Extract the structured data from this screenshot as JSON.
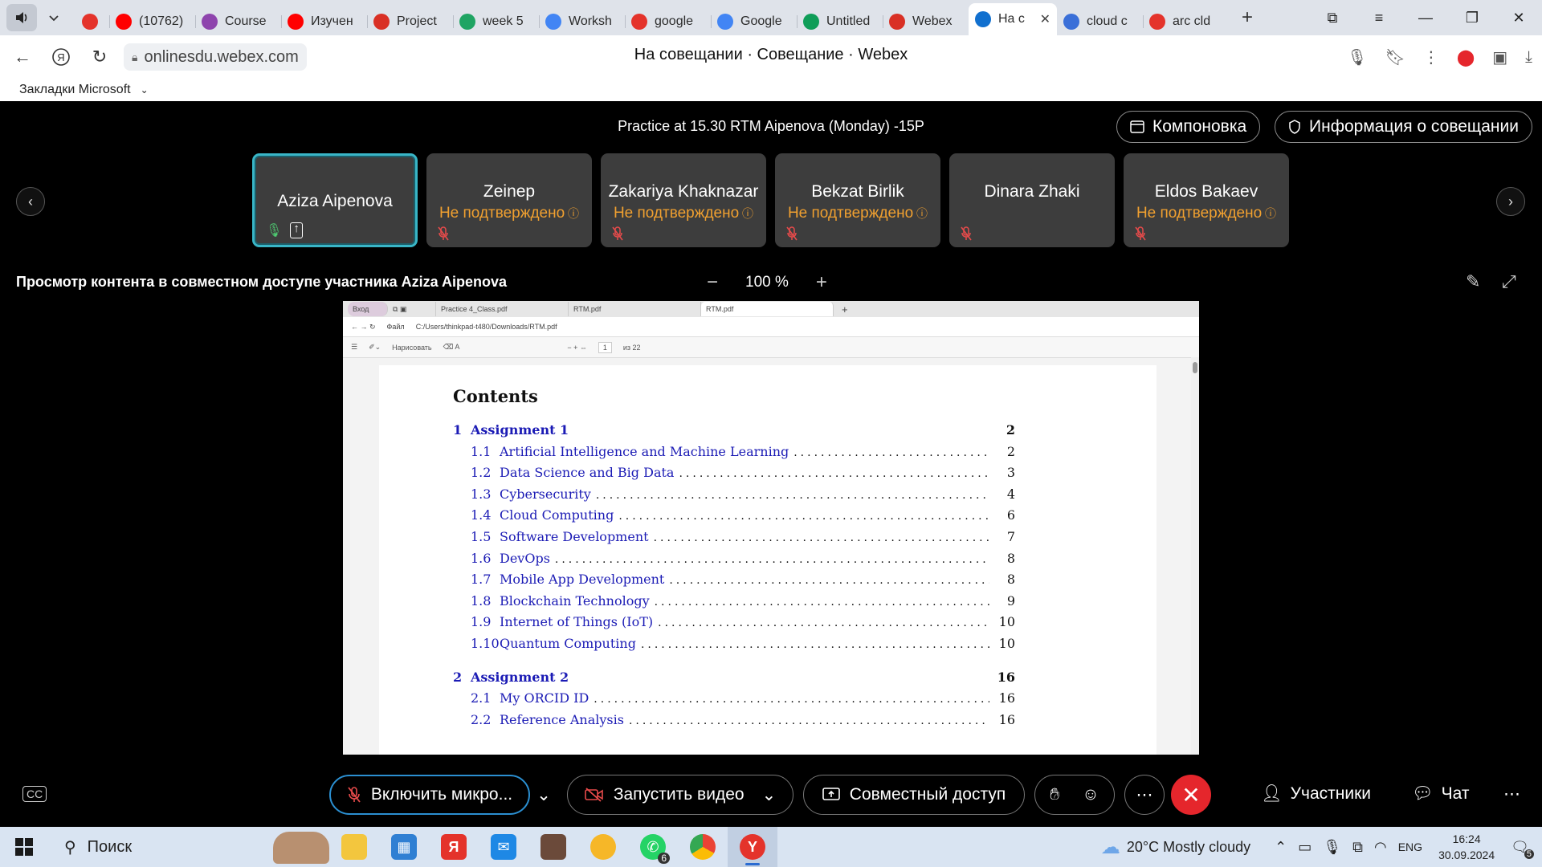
{
  "browser": {
    "tabs": [
      {
        "label": "",
        "favicon": "yandex-icon",
        "color": "#e4332b"
      },
      {
        "label": "(10762)",
        "favicon": "youtube-icon",
        "color": "#ff0000"
      },
      {
        "label": "Course",
        "favicon": "coursera-icon",
        "color": "#8e44ad"
      },
      {
        "label": "Изучен",
        "favicon": "youtube-icon",
        "color": "#ff0000"
      },
      {
        "label": "Project",
        "favicon": "gmail-icon",
        "color": "#d93025"
      },
      {
        "label": "week 5",
        "favicon": "drive-icon",
        "color": "#1fa463"
      },
      {
        "label": "Worksh",
        "favicon": "docs-icon",
        "color": "#4285f4"
      },
      {
        "label": "google",
        "favicon": "yandex-icon",
        "color": "#e4332b"
      },
      {
        "label": "Google",
        "favicon": "google-icon",
        "color": "#4285f4"
      },
      {
        "label": "Untitled",
        "favicon": "sheets-icon",
        "color": "#0f9d58"
      },
      {
        "label": "Webex",
        "favicon": "gmail-icon",
        "color": "#d93025"
      },
      {
        "label": "На с",
        "favicon": "webex-icon",
        "color": "#1170cf",
        "active": true
      },
      {
        "label": "cloud c",
        "favicon": "gemini-icon",
        "color": "#3a6fd8"
      },
      {
        "label": "arc cld",
        "favicon": "yandex-icon",
        "color": "#e4332b"
      }
    ],
    "url": "onlinesdu.webex.com",
    "page_title": "На совещании · Совещание · Webex",
    "bookmarks_label": "Закладки Microsoft"
  },
  "meeting": {
    "title": "Practice at 15.30 RTM Aipenova (Monday) -15P",
    "layout_button": "Компоновка",
    "info_button": "Информация о совещании",
    "participants": [
      {
        "name": "Aziza Aipenova",
        "status": "",
        "active": true
      },
      {
        "name": "Zeinep",
        "status": "Не подтверждено"
      },
      {
        "name": "Zakariya Khaknazar",
        "status": "Не подтверждено"
      },
      {
        "name": "Bekzat Birlik",
        "status": "Не подтверждено"
      },
      {
        "name": "Dinara Zhaki",
        "status": ""
      },
      {
        "name": "Eldos Bakaev",
        "status": "Не подтверждено"
      }
    ],
    "share_title": "Просмотр контента в совместном доступе участника Aziza Aipenova",
    "zoom": "100 %",
    "controls": {
      "mic": "Включить микро...",
      "video": "Запустить видео",
      "share": "Совместный доступ",
      "participants": "Участники",
      "chat": "Чат"
    }
  },
  "shared_screen": {
    "tabs": [
      "Вход",
      "Practice 4_Class.pdf",
      "RTM.pdf",
      "RTM.pdf"
    ],
    "file_label": "Файл",
    "path": "C:/Users/thinkpad-t480/Downloads/RTM.pdf",
    "draw_label": "Нарисовать",
    "page_current": "1",
    "page_total": "из 22",
    "toc_heading": "Contents",
    "toc": [
      {
        "num": "1",
        "title": "Assignment 1",
        "page": "2",
        "level": 1
      },
      {
        "num": "1.1",
        "title": "Artificial Intelligence and Machine Learning",
        "page": "2",
        "level": 2
      },
      {
        "num": "1.2",
        "title": "Data Science and Big Data",
        "page": "3",
        "level": 2
      },
      {
        "num": "1.3",
        "title": "Cybersecurity",
        "page": "4",
        "level": 2
      },
      {
        "num": "1.4",
        "title": "Cloud Computing",
        "page": "6",
        "level": 2
      },
      {
        "num": "1.5",
        "title": "Software Development",
        "page": "7",
        "level": 2
      },
      {
        "num": "1.6",
        "title": "DevOps",
        "page": "8",
        "level": 2
      },
      {
        "num": "1.7",
        "title": "Mobile App Development",
        "page": "8",
        "level": 2
      },
      {
        "num": "1.8",
        "title": "Blockchain Technology",
        "page": "9",
        "level": 2
      },
      {
        "num": "1.9",
        "title": "Internet of Things (IoT)",
        "page": "10",
        "level": 2
      },
      {
        "num": "1.10",
        "title": "Quantum Computing",
        "page": "10",
        "level": 2
      },
      {
        "num": "2",
        "title": "Assignment 2",
        "page": "16",
        "level": 1
      },
      {
        "num": "2.1",
        "title": "My ORCID ID",
        "page": "16",
        "level": 2
      },
      {
        "num": "2.2",
        "title": "Reference Analysis",
        "page": "16",
        "level": 2
      }
    ]
  },
  "taskbar": {
    "search": "Поиск",
    "weather": "20°C  Mostly cloudy",
    "lang": "ENG",
    "time": "16:24",
    "date": "30.09.2024",
    "whatsapp_badge": "6",
    "notif_badge": "5"
  },
  "colors": {
    "accent": "#39b6c7",
    "warning": "#f0a030",
    "end_call": "#e5262c",
    "link": "#1b1bb5"
  }
}
